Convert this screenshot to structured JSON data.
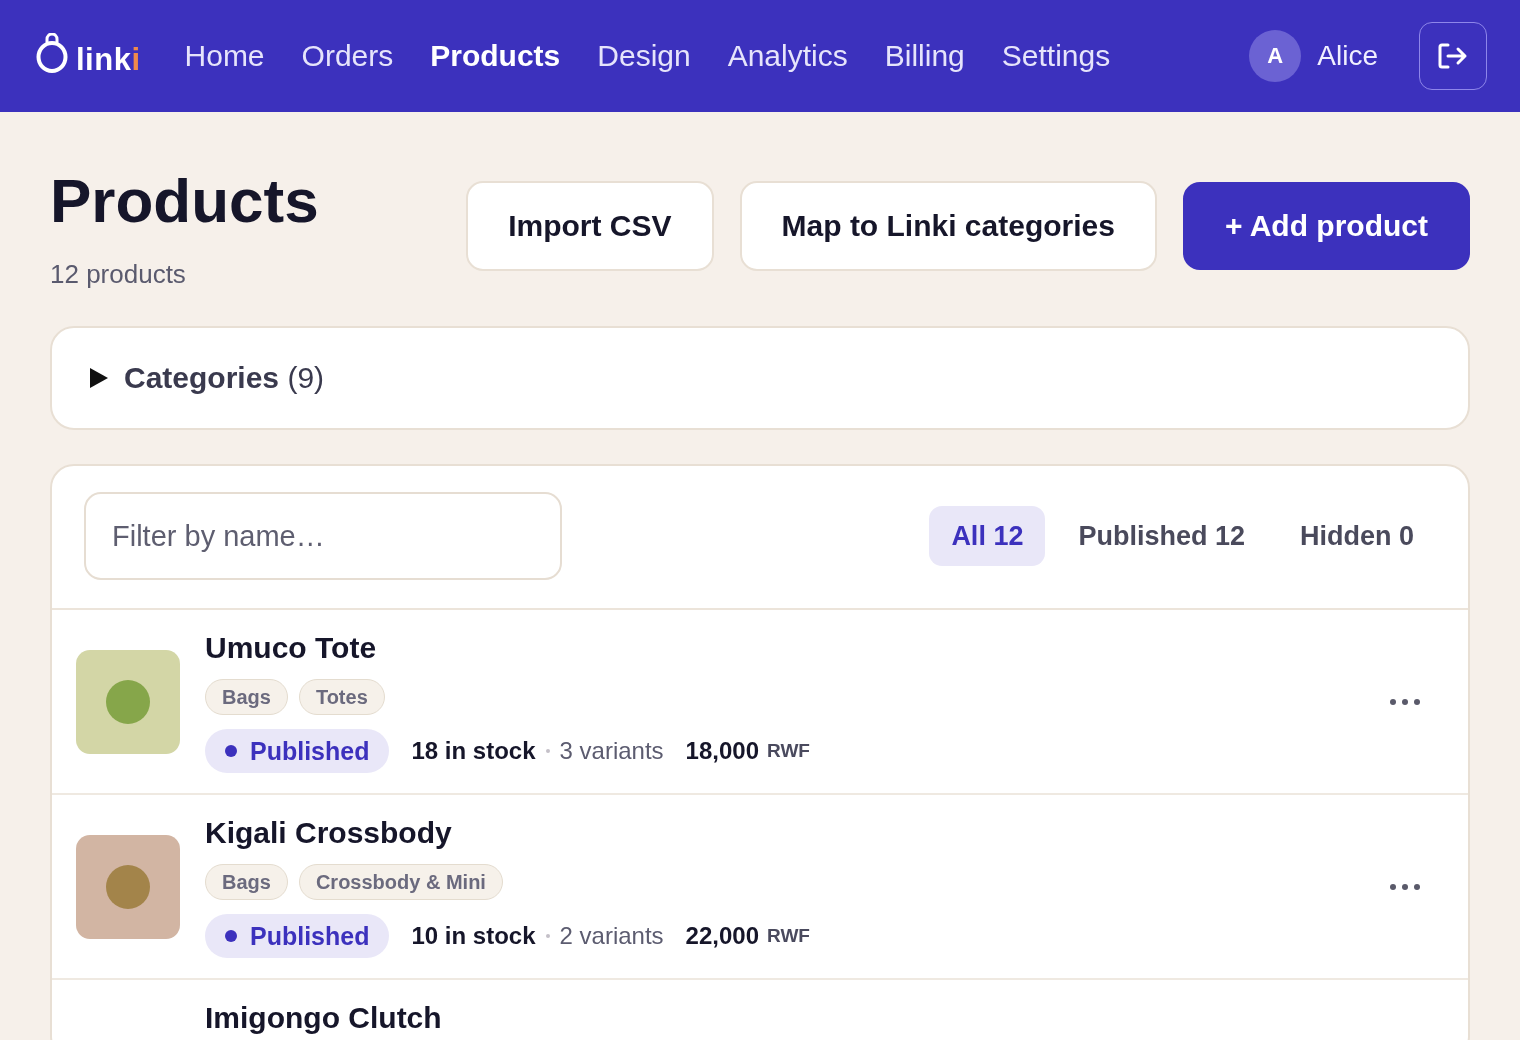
{
  "navbar": {
    "logo": {
      "text": "linki"
    },
    "items": [
      {
        "label": "Home",
        "selected": false
      },
      {
        "label": "Orders",
        "selected": false
      },
      {
        "label": "Products",
        "selected": true
      },
      {
        "label": "Design",
        "selected": false
      },
      {
        "label": "Analytics",
        "selected": false
      },
      {
        "label": "Billing",
        "selected": false
      },
      {
        "label": "Settings",
        "selected": false
      }
    ],
    "user": {
      "initial": "A",
      "name": "Alice"
    }
  },
  "header": {
    "title": "Products",
    "subtitle": "12 products",
    "buttons": [
      {
        "label": "Import CSV",
        "kind": "secondary"
      },
      {
        "label": "Map to Linki categories",
        "kind": "secondary"
      },
      {
        "label": "+ Add product",
        "kind": "primary"
      }
    ]
  },
  "categories": {
    "label": "**Categories** (9)",
    "expanded": false
  },
  "filter": {
    "placeholder": "Filter by name…"
  },
  "tabs": [
    {
      "label": "All 12",
      "selected": true
    },
    {
      "label": "Published 12",
      "selected": false
    },
    {
      "label": "Hidden 0",
      "selected": false
    }
  ],
  "products": [
    {
      "name": "Umuco Tote",
      "thumbnail": {
        "color": "#d3d6a6",
        "dot": {
          "color": "#86a64a"
        }
      },
      "tags": [
        "Bags",
        "Totes"
      ],
      "status": {
        "label": "Published",
        "kind": "published"
      },
      "stock": "18 in stock",
      "variants": "3 variants",
      "price": "18,000",
      "currency": "RWF"
    },
    {
      "name": "Kigali Crossbody",
      "thumbnail": {
        "color": "#d2b5a3",
        "dot": {
          "color": "#a3844a"
        }
      },
      "tags": [
        "Bags",
        "Crossbody & Mini"
      ],
      "status": {
        "label": "Published",
        "kind": "published"
      },
      "stock": "10 in stock",
      "variants": "2 variants",
      "price": "22,000",
      "currency": "RWF"
    },
    {
      "name": "Imigongo Clutch"
    }
  ]
}
